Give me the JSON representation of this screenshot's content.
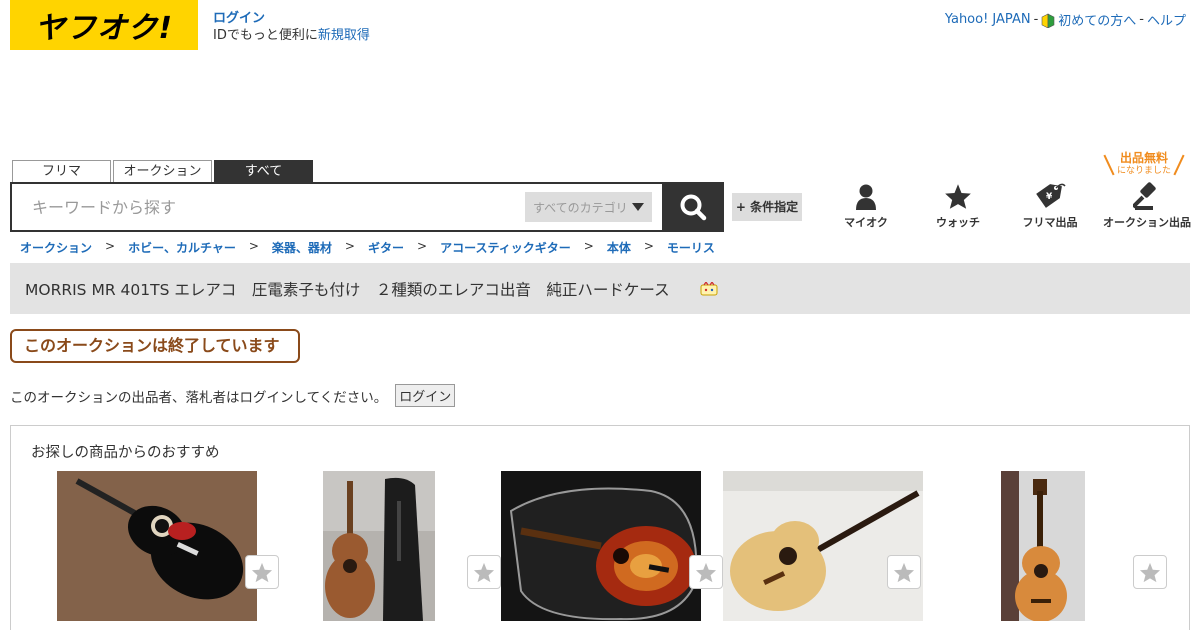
{
  "header": {
    "logo_text": "ヤフオク!",
    "login_link": "ログイン",
    "login_line2_prefix": "IDでもっと便利に",
    "register_link": "新規取得",
    "yahoo_japan": "Yahoo! JAPAN",
    "sep1": "-",
    "beginner": "初めての方へ",
    "sep2": "-",
    "help": "ヘルプ"
  },
  "search": {
    "tabs": [
      {
        "label": "フリマ",
        "active": false
      },
      {
        "label": "オークション",
        "active": false
      },
      {
        "label": "すべて",
        "active": true
      }
    ],
    "placeholder": "キーワードから探す",
    "category": "すべてのカテゴリ",
    "condition_button": "+ 条件指定"
  },
  "nav": {
    "free_listing_badge": "出品無料",
    "free_listing_sub": "になりました",
    "items": [
      {
        "label": "マイオク",
        "icon": "person-icon"
      },
      {
        "label": "ウォッチ",
        "icon": "star-icon"
      },
      {
        "label": "フリマ出品",
        "icon": "price-tag-icon"
      },
      {
        "label": "オークション出品",
        "icon": "gavel-icon"
      }
    ]
  },
  "breadcrumb": [
    "オークション",
    "ホビー、カルチャー",
    "楽器、器材",
    "ギター",
    "アコースティックギター",
    "本体",
    "モーリス"
  ],
  "breadcrumb_sep": ">",
  "item": {
    "title": "MORRIS MR 401TS エレアコ　圧電素子も付け　２種類のエレアコ出音　純正ハードケース"
  },
  "status": {
    "ended": "このオークションは終了しています",
    "login_notice": "このオークションの出品者、落札者はログインしてください。",
    "login_button": "ログイン"
  },
  "recommend": {
    "title": "お探しの商品からのおすすめ"
  },
  "colors": {
    "brand_yellow": "#ffd400",
    "link_blue": "#1e6bb8",
    "ended_brown": "#8a4a1a",
    "badge_orange": "#f08c1e"
  }
}
